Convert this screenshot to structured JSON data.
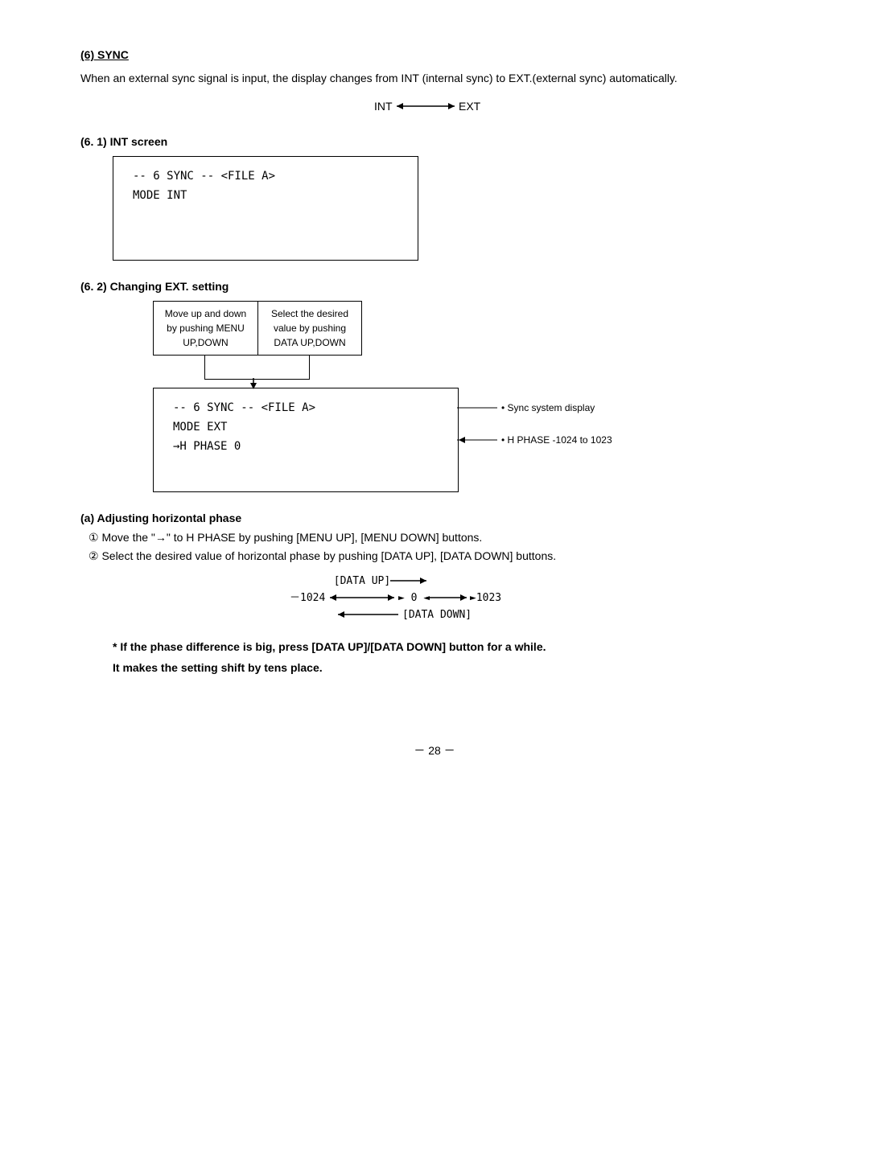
{
  "section6": {
    "title": "(6)  SYNC",
    "desc": "When an external sync signal is input, the display changes from INT (internal sync) to EXT.(external sync) automatically.",
    "int_ext_arrow": "INT◄——► EXT",
    "sub1": {
      "title": "(6. 1)  INT screen",
      "screen_line1": "--  6  SYNC --      <FILE A>",
      "screen_line2": "MODE          INT"
    },
    "sub2": {
      "title": "(6. 2)  Changing EXT. setting",
      "label_left": "Move up and down by pushing MENU UP,DOWN",
      "label_right": "Select the desired value by pushing DATA UP,DOWN",
      "screen_line1": "--  6  SYNC --      <FILE A>",
      "screen_line2": "MODE          EXT",
      "screen_line3": "→H PHASE       0",
      "annot1": "• Sync system display",
      "annot2": "• H PHASE   -1024 to 1023"
    },
    "adj": {
      "title": "(a) Adjusting horizontal phase",
      "step1": "① Move the \"→\" to H PHASE by pushing [MENU UP], [MENU DOWN] buttons.",
      "step2": "② Select the desired value of horizontal phase by pushing [DATA UP], [DATA DOWN] buttons.",
      "data_up_label": "[DATA UP]",
      "data_down_label": "[DATA DOWN]",
      "range_left": "－1024◄",
      "range_mid": "► 0 ◄",
      "range_right": "►1023",
      "note": "* If the phase difference is big, press [DATA UP]/[DATA DOWN] button for a while.\n  It makes the setting shift by tens place."
    }
  },
  "page_number": "－ 28 －"
}
